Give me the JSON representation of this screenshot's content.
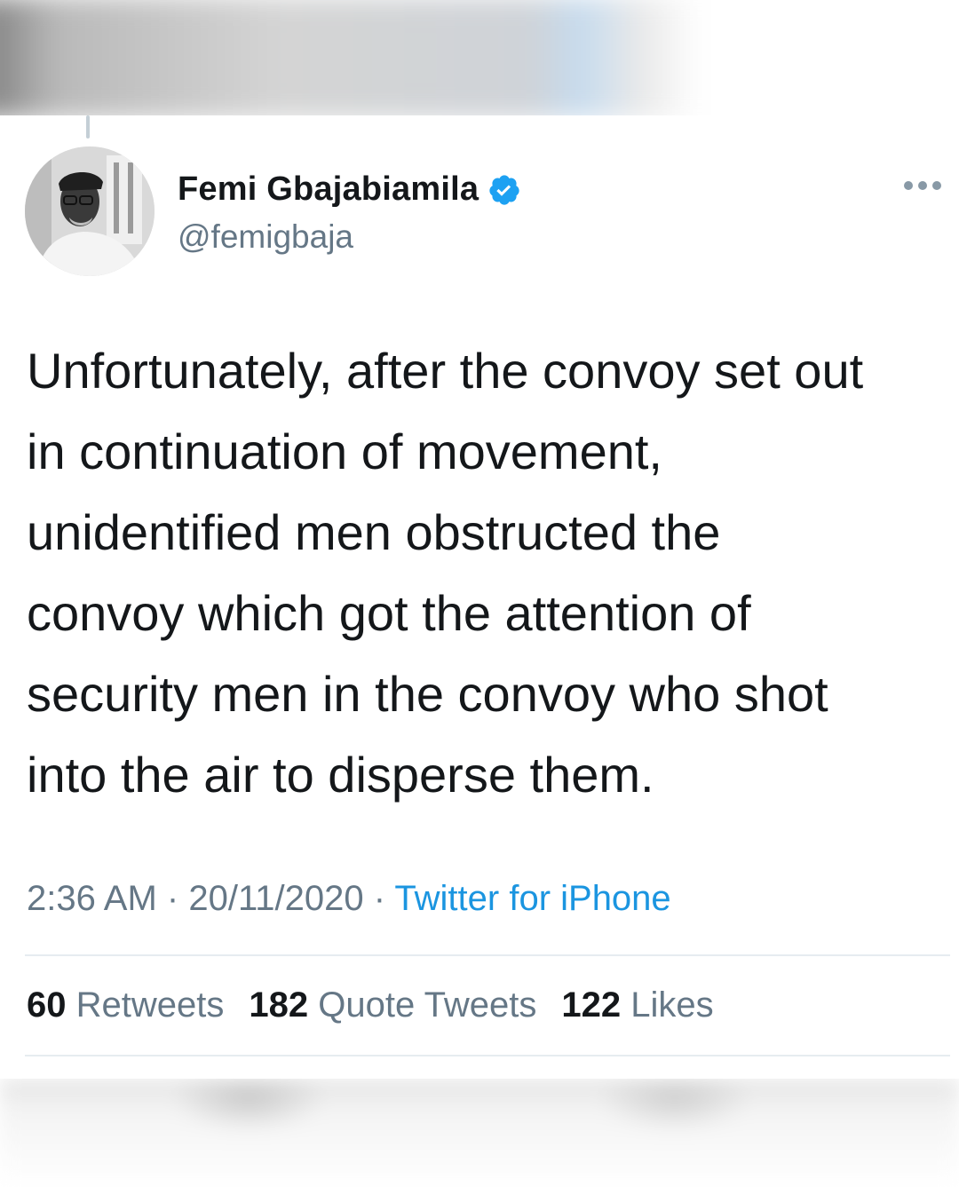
{
  "author": {
    "name": "Femi Gbajabiamila",
    "handle": "@femigbaja",
    "verified": true,
    "avatar_icon": "profile-photo"
  },
  "tweet": {
    "text": "Unfortunately, after the convoy set out\nin continuation of movement,\nunidentified men obstructed the\nconvoy which got the attention of\nsecurity men in the convoy who shot\ninto the air to disperse them.",
    "time": "2:36 AM",
    "date": "20/11/2020",
    "separator": "·",
    "source": "Twitter for iPhone"
  },
  "stats": {
    "retweets_count": "60",
    "retweets_label": "Retweets",
    "quote_tweets_count": "182",
    "quote_tweets_label": "Quote Tweets",
    "likes_count": "122",
    "likes_label": "Likes"
  },
  "colors": {
    "text": "#14171a",
    "secondary": "#657786",
    "link": "#1b95e0",
    "verified": "#1da1f2",
    "divider": "#e6ecf0"
  }
}
